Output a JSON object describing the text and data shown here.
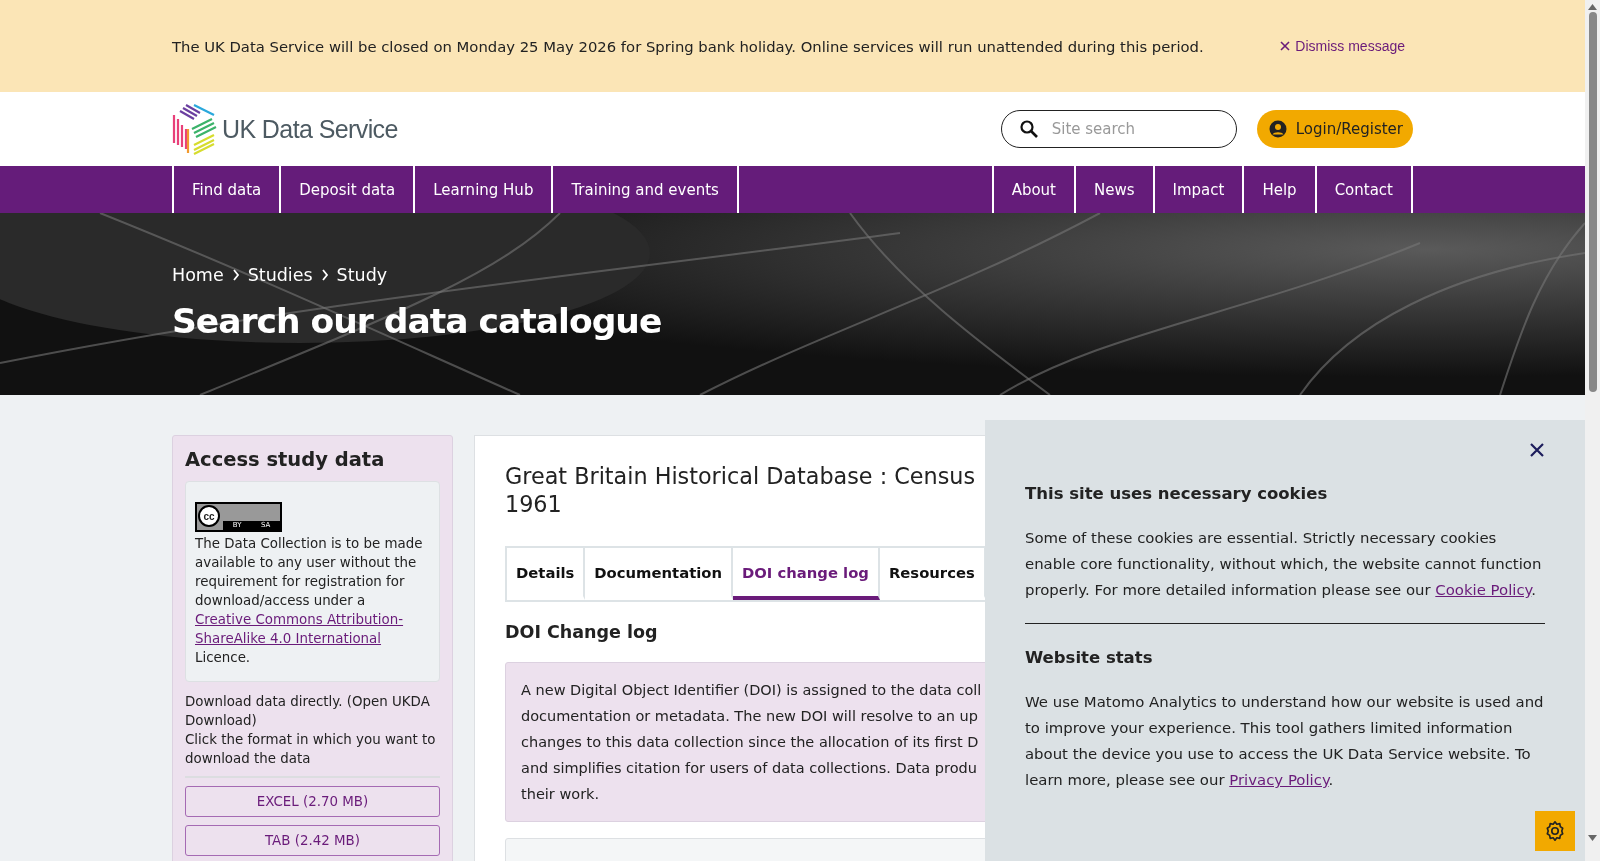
{
  "banner": {
    "message": "The UK Data Service will be closed on Monday 25 May 2026 for Spring bank holiday. Online services will run unattended during this period.",
    "dismiss": "Dismiss message"
  },
  "header": {
    "logo": "UK Data Service",
    "search": {
      "placeholder": "Site search"
    },
    "login": "Login/Register"
  },
  "nav": {
    "left": [
      "Find data",
      "Deposit data",
      "Learning Hub",
      "Training and events"
    ],
    "right": [
      "About",
      "News",
      "Impact",
      "Help",
      "Contact"
    ]
  },
  "hero": {
    "breadcrumb": [
      "Home",
      "Studies",
      "Study"
    ],
    "title": "Search our data catalogue"
  },
  "sidebar": {
    "title": "Access study data",
    "badge": {
      "symbol": "cc",
      "labels": [
        "BY",
        "SA"
      ]
    },
    "licence": {
      "text_before": "The Data Collection is to be made available to any user without the requirement for registration for download/access under a ",
      "link": "Creative Commons Attribution-ShareAlike 4.0 International",
      "text_after": " Licence."
    },
    "download_note": "Download data directly. (Open UKDA Download)",
    "instruction": "Click the format in which you want to download the data",
    "buttons": [
      "EXCEL (2.70 MB)",
      "TAB (2.42 MB)"
    ]
  },
  "study": {
    "title": "Great Britain Historical Database : Census 1961",
    "tabs": [
      {
        "label": "Details",
        "selected": false
      },
      {
        "label": "Documentation",
        "selected": false
      },
      {
        "label": "DOI change log",
        "selected": true
      },
      {
        "label": "Resources",
        "selected": false
      }
    ],
    "section_title": "DOI Change log",
    "notice_lines": [
      "A new Digital Object Identifier (DOI) is assigned to the data coll",
      "documentation or metadata. The new DOI will resolve to an up",
      "changes to this data collection since the allocation of its first D",
      "and simplifies citation for users of data collections. Data produ",
      "their work."
    ]
  },
  "cookie_panel": {
    "sections": [
      {
        "title": "This site uses necessary cookies",
        "text_before": "Some of these cookies are essential. Strictly necessary cookies enable core functionality, without which, the website cannot function properly. For more detailed information please see our ",
        "link": "Cookie Policy",
        "text_after": "."
      },
      {
        "title": "Website stats",
        "text_before": "We use Matomo Analytics to understand how our website is used and to improve your experience. This tool gathers limited information about the device you use to access the UK Data Service website. To learn more, please see our ",
        "link": "Privacy Policy",
        "text_after": "."
      }
    ]
  }
}
